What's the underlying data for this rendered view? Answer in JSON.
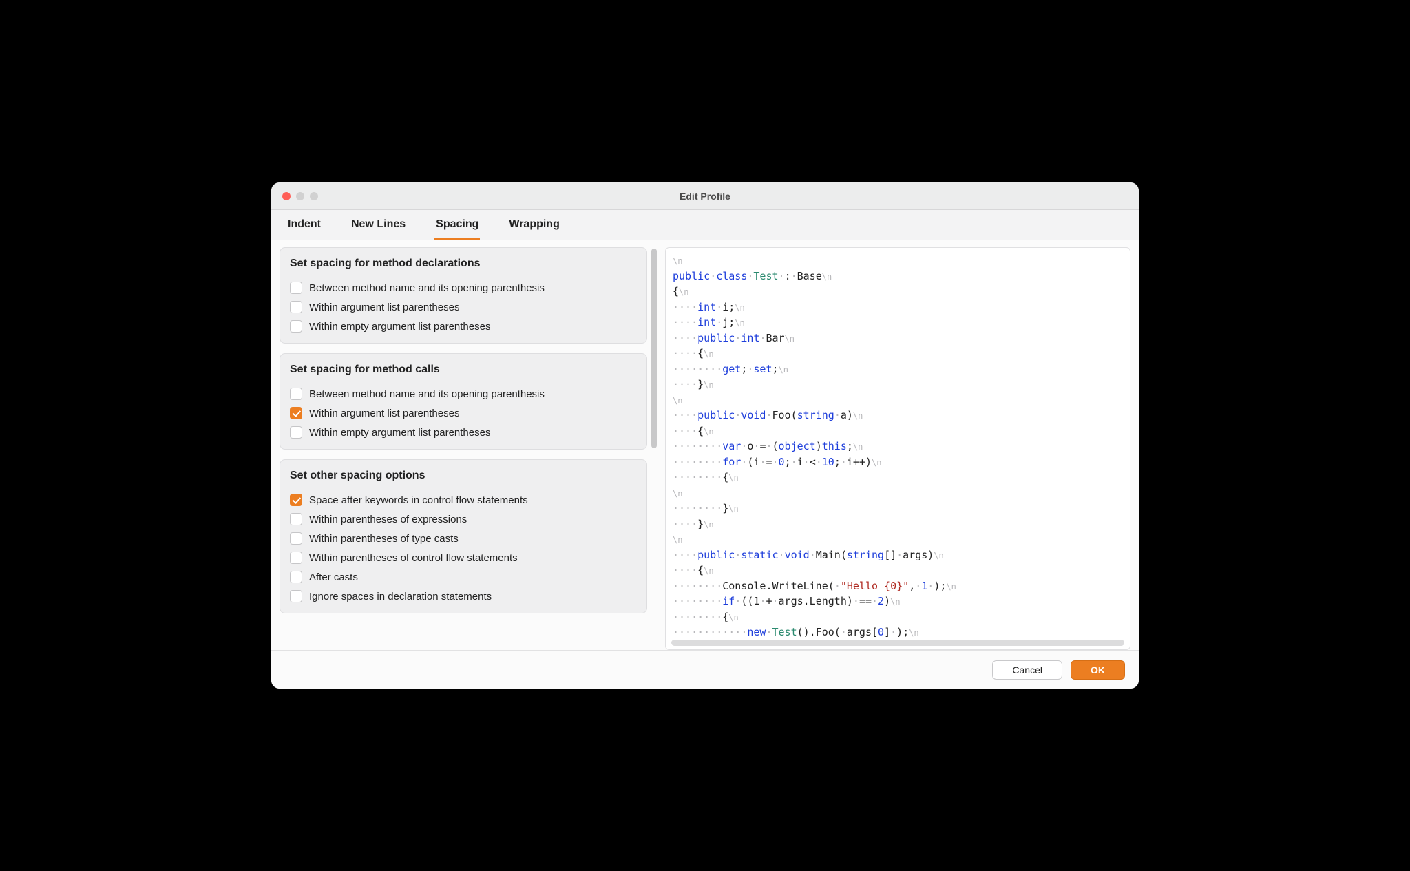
{
  "title": "Edit Profile",
  "tabs": [
    {
      "label": "Indent",
      "active": false
    },
    {
      "label": "New Lines",
      "active": false
    },
    {
      "label": "Spacing",
      "active": true
    },
    {
      "label": "Wrapping",
      "active": false
    }
  ],
  "groups": [
    {
      "title": "Set spacing for method declarations",
      "options": [
        {
          "label": "Between method name and its opening parenthesis",
          "checked": false
        },
        {
          "label": "Within argument list parentheses",
          "checked": false
        },
        {
          "label": "Within empty argument list parentheses",
          "checked": false
        }
      ]
    },
    {
      "title": "Set spacing for method calls",
      "options": [
        {
          "label": "Between method name and its opening parenthesis",
          "checked": false
        },
        {
          "label": "Within argument list parentheses",
          "checked": true
        },
        {
          "label": "Within empty argument list parentheses",
          "checked": false
        }
      ]
    },
    {
      "title": "Set other spacing options",
      "options": [
        {
          "label": "Space after keywords in control flow statements",
          "checked": true
        },
        {
          "label": "Within parentheses of expressions",
          "checked": false
        },
        {
          "label": "Within parentheses of type casts",
          "checked": false
        },
        {
          "label": "Within parentheses of control flow statements",
          "checked": false
        },
        {
          "label": "After casts",
          "checked": false
        },
        {
          "label": "Ignore spaces in declaration statements",
          "checked": false
        }
      ]
    }
  ],
  "code": {
    "lines": [
      {
        "t": [
          [
            "nl",
            "\\n"
          ]
        ]
      },
      {
        "t": [
          [
            "kw",
            "public"
          ],
          [
            "dot",
            "·"
          ],
          [
            "kw",
            "class"
          ],
          [
            "dot",
            "·"
          ],
          [
            "ty",
            "Test"
          ],
          [
            "dot",
            "·"
          ],
          [
            "",
            ":"
          ],
          [
            "dot",
            "·"
          ],
          [
            "",
            "Base"
          ],
          [
            "nl",
            "\\n"
          ]
        ]
      },
      {
        "t": [
          [
            "",
            "{"
          ],
          [
            "nl",
            "\\n"
          ]
        ]
      },
      {
        "t": [
          [
            "dot",
            "····"
          ],
          [
            "kw",
            "int"
          ],
          [
            "dot",
            "·"
          ],
          [
            "",
            "i;"
          ],
          [
            "nl",
            "\\n"
          ]
        ]
      },
      {
        "t": [
          [
            "dot",
            "····"
          ],
          [
            "kw",
            "int"
          ],
          [
            "dot",
            "·"
          ],
          [
            "",
            "j;"
          ],
          [
            "nl",
            "\\n"
          ]
        ]
      },
      {
        "t": [
          [
            "dot",
            "····"
          ],
          [
            "kw",
            "public"
          ],
          [
            "dot",
            "·"
          ],
          [
            "kw",
            "int"
          ],
          [
            "dot",
            "·"
          ],
          [
            "",
            "Bar"
          ],
          [
            "nl",
            "\\n"
          ]
        ]
      },
      {
        "t": [
          [
            "dot",
            "····"
          ],
          [
            "",
            "{"
          ],
          [
            "nl",
            "\\n"
          ]
        ]
      },
      {
        "t": [
          [
            "dot",
            "········"
          ],
          [
            "kw",
            "get"
          ],
          [
            "",
            ";"
          ],
          [
            "dot",
            "·"
          ],
          [
            "kw",
            "set"
          ],
          [
            "",
            ";"
          ],
          [
            "nl",
            "\\n"
          ]
        ]
      },
      {
        "t": [
          [
            "dot",
            "····"
          ],
          [
            "",
            "}"
          ],
          [
            "nl",
            "\\n"
          ]
        ]
      },
      {
        "t": [
          [
            "nl",
            "\\n"
          ]
        ]
      },
      {
        "t": [
          [
            "dot",
            "····"
          ],
          [
            "kw",
            "public"
          ],
          [
            "dot",
            "·"
          ],
          [
            "kw",
            "void"
          ],
          [
            "dot",
            "·"
          ],
          [
            "",
            "Foo("
          ],
          [
            "kw",
            "string"
          ],
          [
            "dot",
            "·"
          ],
          [
            "",
            "a)"
          ],
          [
            "nl",
            "\\n"
          ]
        ]
      },
      {
        "t": [
          [
            "dot",
            "····"
          ],
          [
            "",
            "{"
          ],
          [
            "nl",
            "\\n"
          ]
        ]
      },
      {
        "t": [
          [
            "dot",
            "········"
          ],
          [
            "kw",
            "var"
          ],
          [
            "dot",
            "·"
          ],
          [
            "",
            "o"
          ],
          [
            "dot",
            "·"
          ],
          [
            "",
            "="
          ],
          [
            "dot",
            "·"
          ],
          [
            "",
            "("
          ],
          [
            "kw",
            "object"
          ],
          [
            "",
            ")"
          ],
          [
            "kw",
            "this"
          ],
          [
            "",
            ";"
          ],
          [
            "nl",
            "\\n"
          ]
        ]
      },
      {
        "t": [
          [
            "dot",
            "········"
          ],
          [
            "kw",
            "for"
          ],
          [
            "dot",
            "·"
          ],
          [
            "",
            "(i"
          ],
          [
            "dot",
            "·"
          ],
          [
            "",
            "="
          ],
          [
            "dot",
            "·"
          ],
          [
            "nm",
            "0"
          ],
          [
            "",
            ";"
          ],
          [
            "dot",
            "·"
          ],
          [
            "",
            "i"
          ],
          [
            "dot",
            "·"
          ],
          [
            "",
            "<"
          ],
          [
            "dot",
            "·"
          ],
          [
            "nm",
            "10"
          ],
          [
            "",
            ";"
          ],
          [
            "dot",
            "·"
          ],
          [
            "",
            "i++)"
          ],
          [
            "nl",
            "\\n"
          ]
        ]
      },
      {
        "t": [
          [
            "dot",
            "········"
          ],
          [
            "",
            "{"
          ],
          [
            "nl",
            "\\n"
          ]
        ]
      },
      {
        "t": [
          [
            "nl",
            "\\n"
          ]
        ]
      },
      {
        "t": [
          [
            "dot",
            "········"
          ],
          [
            "",
            "}"
          ],
          [
            "nl",
            "\\n"
          ]
        ]
      },
      {
        "t": [
          [
            "dot",
            "····"
          ],
          [
            "",
            "}"
          ],
          [
            "nl",
            "\\n"
          ]
        ]
      },
      {
        "t": [
          [
            "nl",
            "\\n"
          ]
        ]
      },
      {
        "t": [
          [
            "dot",
            "····"
          ],
          [
            "kw",
            "public"
          ],
          [
            "dot",
            "·"
          ],
          [
            "kw",
            "static"
          ],
          [
            "dot",
            "·"
          ],
          [
            "kw",
            "void"
          ],
          [
            "dot",
            "·"
          ],
          [
            "",
            "Main("
          ],
          [
            "kw",
            "string"
          ],
          [
            "",
            "[]"
          ],
          [
            "dot",
            "·"
          ],
          [
            "",
            "args)"
          ],
          [
            "nl",
            "\\n"
          ]
        ]
      },
      {
        "t": [
          [
            "dot",
            "····"
          ],
          [
            "",
            "{"
          ],
          [
            "nl",
            "\\n"
          ]
        ]
      },
      {
        "t": [
          [
            "dot",
            "········"
          ],
          [
            "",
            "Console.WriteLine("
          ],
          [
            "dot",
            "·"
          ],
          [
            "st",
            "\"Hello {0}\""
          ],
          [
            "",
            ","
          ],
          [
            "dot",
            "·"
          ],
          [
            "nm",
            "1"
          ],
          [
            "dot",
            "·"
          ],
          [
            "",
            ");"
          ],
          [
            "nl",
            "\\n"
          ]
        ]
      },
      {
        "t": [
          [
            "dot",
            "········"
          ],
          [
            "kw",
            "if"
          ],
          [
            "dot",
            "·"
          ],
          [
            "",
            "((1"
          ],
          [
            "dot",
            "·"
          ],
          [
            "",
            "+"
          ],
          [
            "dot",
            "·"
          ],
          [
            "",
            "args.Length)"
          ],
          [
            "dot",
            "·"
          ],
          [
            "",
            "=="
          ],
          [
            "dot",
            "·"
          ],
          [
            "nm",
            "2"
          ],
          [
            "",
            ")"
          ],
          [
            "nl",
            "\\n"
          ]
        ]
      },
      {
        "t": [
          [
            "dot",
            "········"
          ],
          [
            "",
            "{"
          ],
          [
            "nl",
            "\\n"
          ]
        ]
      },
      {
        "t": [
          [
            "dot",
            "············"
          ],
          [
            "kw",
            "new"
          ],
          [
            "dot",
            "·"
          ],
          [
            "ty",
            "Test"
          ],
          [
            "",
            "().Foo("
          ],
          [
            "dot",
            "·"
          ],
          [
            "",
            "args["
          ],
          [
            "nm",
            "0"
          ],
          [
            "",
            "]"
          ],
          [
            "dot",
            "·"
          ],
          [
            "",
            ");"
          ],
          [
            "nl",
            "\\n"
          ]
        ]
      }
    ]
  },
  "footer": {
    "cancel": "Cancel",
    "ok": "OK"
  }
}
